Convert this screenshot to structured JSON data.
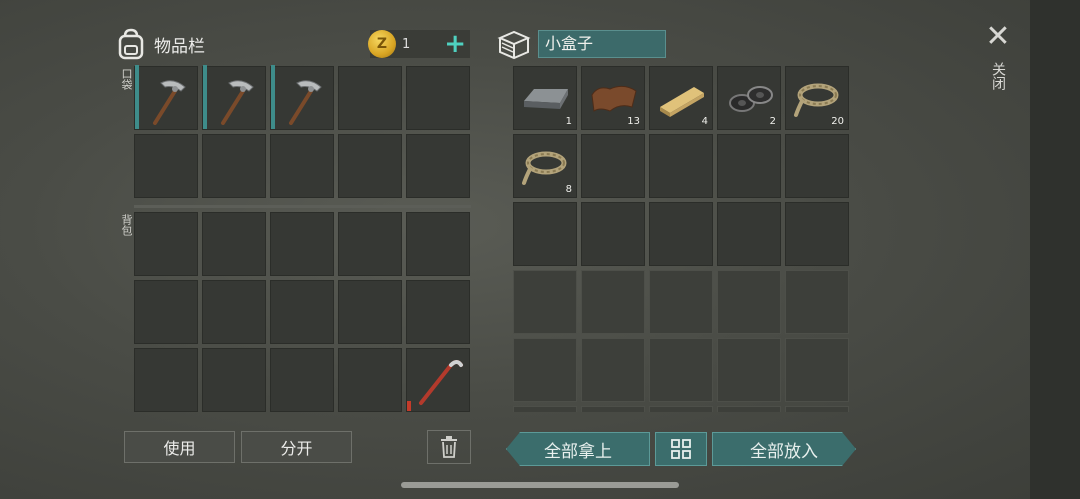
{
  "inventory": {
    "title": "物品栏",
    "icon": "backpack-icon",
    "pocket_label": "口袋",
    "backpack_label": "背包",
    "coins": "1",
    "coin_symbol": "Z",
    "add_label": "+",
    "pocket_slots": [
      {
        "item": "pickaxe-icon",
        "qty": "",
        "durability": "teal"
      },
      {
        "item": "pickaxe-icon",
        "qty": "",
        "durability": "teal"
      },
      {
        "item": "pickaxe-icon",
        "qty": "",
        "durability": "teal"
      },
      {
        "item": "",
        "qty": ""
      },
      {
        "item": "",
        "qty": ""
      },
      {
        "item": "",
        "qty": ""
      },
      {
        "item": "",
        "qty": ""
      },
      {
        "item": "",
        "qty": ""
      },
      {
        "item": "",
        "qty": ""
      },
      {
        "item": "",
        "qty": ""
      }
    ],
    "backpack_slots": [
      {
        "item": "",
        "qty": ""
      },
      {
        "item": "",
        "qty": ""
      },
      {
        "item": "",
        "qty": ""
      },
      {
        "item": "",
        "qty": ""
      },
      {
        "item": "",
        "qty": ""
      },
      {
        "item": "",
        "qty": ""
      },
      {
        "item": "",
        "qty": ""
      },
      {
        "item": "",
        "qty": ""
      },
      {
        "item": "",
        "qty": ""
      },
      {
        "item": "",
        "qty": ""
      },
      {
        "item": "",
        "qty": ""
      },
      {
        "item": "",
        "qty": ""
      },
      {
        "item": "",
        "qty": ""
      },
      {
        "item": "",
        "qty": ""
      },
      {
        "item": "crowbar-icon",
        "qty": "",
        "durability": "red"
      }
    ],
    "use_label": "使用",
    "split_label": "分开",
    "trash_icon": "trash-icon"
  },
  "container": {
    "name": "小盒子",
    "icon": "box-icon",
    "slots": [
      {
        "item": "iron-bar-icon",
        "qty": "1"
      },
      {
        "item": "leather-icon",
        "qty": "13"
      },
      {
        "item": "wood-plank-icon",
        "qty": "4"
      },
      {
        "item": "tape-icon",
        "qty": "2"
      },
      {
        "item": "rope-icon",
        "qty": "20"
      },
      {
        "item": "rope-icon",
        "qty": "8"
      },
      {
        "item": "",
        "qty": ""
      },
      {
        "item": "",
        "qty": ""
      },
      {
        "item": "",
        "qty": ""
      },
      {
        "item": "",
        "qty": ""
      },
      {
        "item": "",
        "qty": ""
      },
      {
        "item": "",
        "qty": ""
      },
      {
        "item": "",
        "qty": ""
      },
      {
        "item": "",
        "qty": ""
      },
      {
        "item": "",
        "qty": ""
      },
      {
        "item": "",
        "qty": "",
        "locked": true
      },
      {
        "item": "",
        "qty": "",
        "locked": true
      },
      {
        "item": "",
        "qty": "",
        "locked": true
      },
      {
        "item": "",
        "qty": "",
        "locked": true
      },
      {
        "item": "",
        "qty": "",
        "locked": true
      },
      {
        "item": "",
        "qty": "",
        "locked": true
      },
      {
        "item": "",
        "qty": "",
        "locked": true
      },
      {
        "item": "",
        "qty": "",
        "locked": true
      },
      {
        "item": "",
        "qty": "",
        "locked": true
      },
      {
        "item": "",
        "qty": "",
        "locked": true
      },
      {
        "item": "",
        "qty": "",
        "locked": true
      },
      {
        "item": "",
        "qty": "",
        "locked": true
      },
      {
        "item": "",
        "qty": "",
        "locked": true
      },
      {
        "item": "",
        "qty": "",
        "locked": true
      },
      {
        "item": "",
        "qty": "",
        "locked": true
      }
    ],
    "take_all_label": "全部拿上",
    "sort_icon": "grid-icon",
    "put_all_label": "全部放入"
  },
  "close": {
    "label": "关闭",
    "icon": "close-icon"
  },
  "colors": {
    "accent": "#3b6d6c",
    "accent_text": "#4fd1c0",
    "coin": "#d8a523"
  }
}
